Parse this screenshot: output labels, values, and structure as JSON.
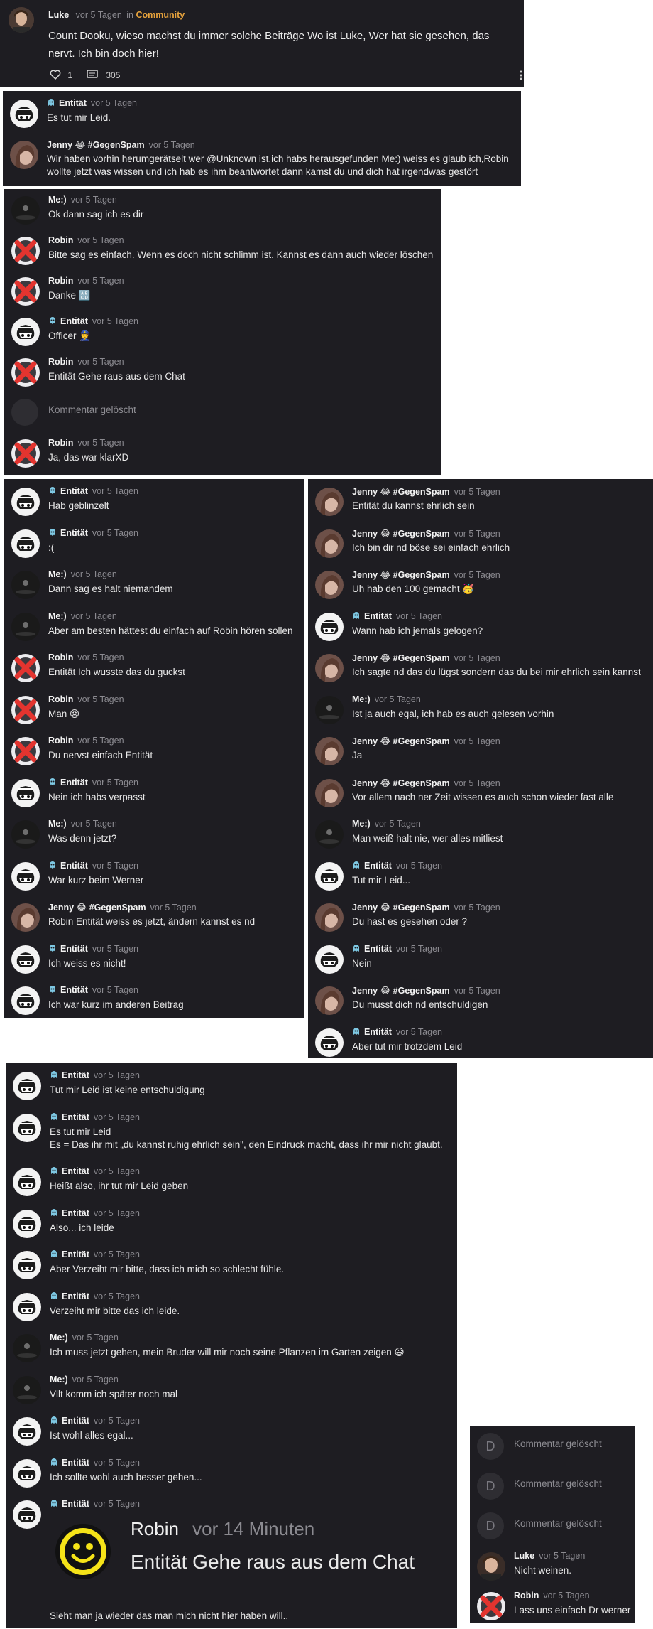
{
  "post": {
    "author": "Luke",
    "time": "vor 5 Tagen",
    "in_label": "in",
    "community": "Community",
    "text_line1": "Count Dooku, wieso machst du immer solche Beiträge Wo ist Luke, Wer hat sie gesehen, das",
    "text_line2": "nervt. Ich bin doch hier!",
    "likes": "1",
    "comments": "305"
  },
  "panel2": [
    {
      "name": "Entität",
      "time": "vor 5 Tagen",
      "text": "Es tut mir Leid.",
      "avatar": "entitaet"
    },
    {
      "name": "Jenny 😂 #GegenSpam",
      "time": "vor 5 Tagen",
      "text": "Wir haben vorhin herumgerätselt wer @Unknown ist,ich habs herausgefunden Me:) weiss es glaub ich,Robin",
      "text2": "wollte jetzt was wissen und ich hab es ihm beantwortet dann kamst du und dich hat irgendwas gestört",
      "avatar": "jenny"
    }
  ],
  "panel3": [
    {
      "name": "Me:)",
      "time": "vor 5 Tagen",
      "text": "Ok dann sag ich es dir",
      "avatar": "me"
    },
    {
      "name": "Robin",
      "time": "vor 5 Tagen",
      "text": "Bitte sag es einfach. Wenn es doch nicht schlimm ist. Kannst es dann auch wieder löschen",
      "avatar": "robin"
    },
    {
      "name": "Robin",
      "time": "vor 5 Tagen",
      "text": "Danke 🔠",
      "avatar": "robin"
    },
    {
      "name": "Entität",
      "time": "vor 5 Tagen",
      "text": "Officer 👮",
      "avatar": "entitaet"
    },
    {
      "name": "Robin",
      "time": "vor 5 Tagen",
      "text": "Entität Gehe raus aus dem Chat",
      "avatar": "robin"
    },
    {
      "deleted": "Kommentar gelöscht"
    },
    {
      "name": "Robin",
      "time": "vor 5 Tagen",
      "text": "Ja, das war klarXD",
      "avatar": "robin"
    }
  ],
  "panel4": [
    {
      "name": "Entität",
      "time": "vor 5 Tagen",
      "text": "Hab geblinzelt",
      "avatar": "entitaet"
    },
    {
      "name": "Entität",
      "time": "vor 5 Tagen",
      "text": ":(",
      "avatar": "entitaet"
    },
    {
      "name": "Me:)",
      "time": "vor 5 Tagen",
      "text": "Dann sag es halt niemandem",
      "avatar": "me"
    },
    {
      "name": "Me:)",
      "time": "vor 5 Tagen",
      "text": "Aber am besten hättest du einfach auf Robin hören sollen",
      "avatar": "me"
    },
    {
      "name": "Robin",
      "time": "vor 5 Tagen",
      "text": "Entität Ich wusste das du guckst",
      "avatar": "robin"
    },
    {
      "name": "Robin",
      "time": "vor 5 Tagen",
      "text": "Man 😡",
      "avatar": "robin"
    },
    {
      "name": "Robin",
      "time": "vor 5 Tagen",
      "text": "Du nervst einfach Entität",
      "avatar": "robin"
    },
    {
      "name": "Entität",
      "time": "vor 5 Tagen",
      "text": "Nein ich habs verpasst",
      "avatar": "entitaet"
    },
    {
      "name": "Me:)",
      "time": "vor 5 Tagen",
      "text": "Was denn jetzt?",
      "avatar": "me"
    },
    {
      "name": "Entität",
      "time": "vor 5 Tagen",
      "text": "War kurz beim Werner",
      "avatar": "entitaet"
    },
    {
      "name": "Jenny 😂 #GegenSpam",
      "time": "vor 5 Tagen",
      "text": "Robin Entität weiss es jetzt, ändern kannst es nd",
      "avatar": "jenny"
    },
    {
      "name": "Entität",
      "time": "vor 5 Tagen",
      "text": "Ich weiss es nicht!",
      "avatar": "entitaet"
    },
    {
      "name": "Entität",
      "time": "vor 5 Tagen",
      "text": "Ich war kurz im anderen Beitrag",
      "avatar": "entitaet"
    }
  ],
  "panel5": [
    {
      "name": "Jenny 😂 #GegenSpam",
      "time": "vor 5 Tagen",
      "text": "Entität du kannst ehrlich sein",
      "avatar": "jenny"
    },
    {
      "name": "Jenny 😂 #GegenSpam",
      "time": "vor 5 Tagen",
      "text": "Ich bin dir nd böse sei einfach ehrlich",
      "avatar": "jenny"
    },
    {
      "name": "Jenny 😂 #GegenSpam",
      "time": "vor 5 Tagen",
      "text": "Uh hab den 100 gemacht 🥳",
      "avatar": "jenny"
    },
    {
      "name": "Entität",
      "time": "vor 5 Tagen",
      "text": "Wann hab ich jemals gelogen?",
      "avatar": "entitaet"
    },
    {
      "name": "Jenny 😂 #GegenSpam",
      "time": "vor 5 Tagen",
      "text": "Ich sagte nd das du lügst sondern das du bei mir ehrlich sein kannst",
      "avatar": "jenny"
    },
    {
      "name": "Me:)",
      "time": "vor 5 Tagen",
      "text": "Ist ja auch egal, ich hab es auch gelesen vorhin",
      "avatar": "me"
    },
    {
      "name": "Jenny 😂 #GegenSpam",
      "time": "vor 5 Tagen",
      "text": "Ja",
      "avatar": "jenny"
    },
    {
      "name": "Jenny 😂 #GegenSpam",
      "time": "vor 5 Tagen",
      "text": "Vor allem nach ner Zeit wissen es auch schon wieder fast alle",
      "avatar": "jenny"
    },
    {
      "name": "Me:)",
      "time": "vor 5 Tagen",
      "text": "Man weiß halt nie, wer alles mitliest",
      "avatar": "me"
    },
    {
      "name": "Entität",
      "time": "vor 5 Tagen",
      "text": "Tut mir Leid...",
      "avatar": "entitaet"
    },
    {
      "name": "Jenny 😂 #GegenSpam",
      "time": "vor 5 Tagen",
      "text": "Du hast es gesehen oder ?",
      "avatar": "jenny"
    },
    {
      "name": "Entität",
      "time": "vor 5 Tagen",
      "text": "Nein",
      "avatar": "entitaet"
    },
    {
      "name": "Jenny 😂 #GegenSpam",
      "time": "vor 5 Tagen",
      "text": "Du musst dich nd entschuldigen",
      "avatar": "jenny"
    },
    {
      "name": "Entität",
      "time": "vor 5 Tagen",
      "text": "Aber tut mir trotzdem Leid",
      "avatar": "entitaet"
    }
  ],
  "panel6": [
    {
      "name": "Entität",
      "time": "vor 5 Tagen",
      "text": "Tut mir Leid ist keine entschuldigung",
      "avatar": "entitaet"
    },
    {
      "name": "Entität",
      "time": "vor 5 Tagen",
      "text": "Es tut mir Leid",
      "text2": "Es = Das ihr mit „du kannst ruhig ehrlich sein\", den Eindruck macht, dass ihr mir nicht glaubt.",
      "avatar": "entitaet"
    },
    {
      "name": "Entität",
      "time": "vor 5 Tagen",
      "text": "Heißt also, ihr tut mir Leid geben",
      "avatar": "entitaet"
    },
    {
      "name": "Entität",
      "time": "vor 5 Tagen",
      "text": "Also... ich leide",
      "avatar": "entitaet"
    },
    {
      "name": "Entität",
      "time": "vor 5 Tagen",
      "text": "Aber Verzeiht mir bitte, dass ich mich so schlecht fühle.",
      "avatar": "entitaet"
    },
    {
      "name": "Entität",
      "time": "vor 5 Tagen",
      "text": "Verzeiht mir bitte das ich leide.",
      "avatar": "entitaet"
    },
    {
      "name": "Me:)",
      "time": "vor 5 Tagen",
      "text": "Ich muss jetzt gehen, mein Bruder will mir noch seine Pflanzen im Garten zeigen 😅",
      "avatar": "me"
    },
    {
      "name": "Me:)",
      "time": "vor 5 Tagen",
      "text": "Vllt komm ich später noch mal",
      "avatar": "me"
    },
    {
      "name": "Entität",
      "time": "vor 5 Tagen",
      "text": "Ist wohl alles egal...",
      "avatar": "entitaet"
    },
    {
      "name": "Entität",
      "time": "vor 5 Tagen",
      "text": "Ich sollte wohl auch besser gehen...",
      "avatar": "entitaet"
    },
    {
      "name": "Entität",
      "time": "vor 5 Tagen",
      "text": "",
      "avatar": "entitaet"
    }
  ],
  "quote": {
    "name": "Robin",
    "time": "vor 14 Minuten",
    "text": "Entität Gehe raus aus dem Chat"
  },
  "panel6_footer": "Sieht man ja wieder das man mich nicht hier haben will..",
  "panel7": [
    {
      "deleted": "Kommentar gelöscht",
      "letter": "D"
    },
    {
      "deleted": "Kommentar gelöscht",
      "letter": "D"
    },
    {
      "deleted": "Kommentar gelöscht",
      "letter": "D"
    },
    {
      "name": "Luke",
      "time": "vor 5 Tagen",
      "text": "Nicht weinen.",
      "avatar": "luke"
    },
    {
      "name": "Robin",
      "time": "vor 5 Tagen",
      "text": "Lass uns einfach Dr werner",
      "avatar": "robin"
    }
  ]
}
